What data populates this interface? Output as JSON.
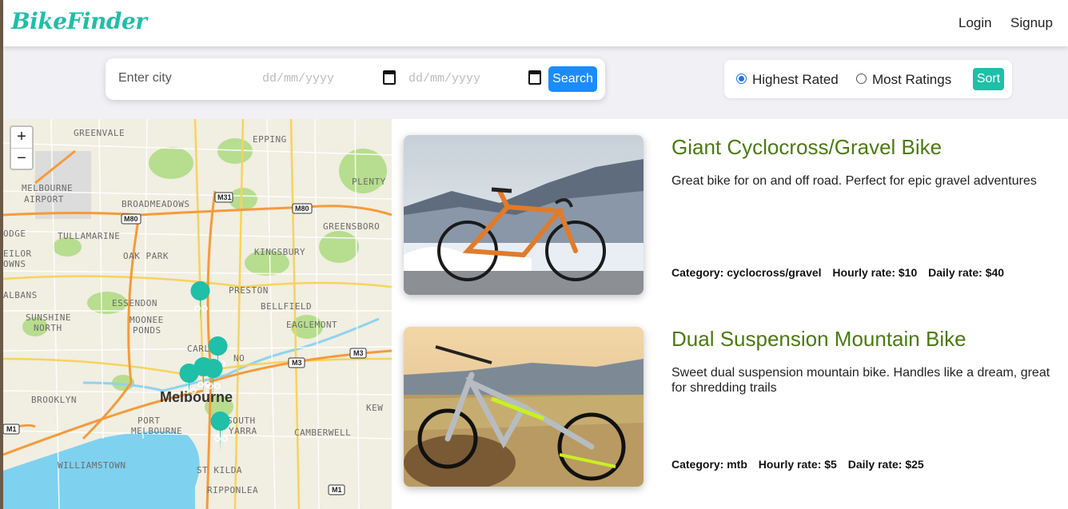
{
  "nav": {
    "brand": "BikeFinder",
    "login": "Login",
    "signup": "Signup"
  },
  "search": {
    "city_placeholder": "Enter city",
    "start_date_placeholder": "dd/mm/yyyy",
    "end_date_placeholder": "dd/mm/yyyy",
    "button": "Search"
  },
  "sort": {
    "option_highest": "Highest Rated",
    "option_most": "Most Ratings",
    "selected": "Highest Rated",
    "button": "Sort"
  },
  "map": {
    "zoom_in": "+",
    "zoom_out": "−",
    "places": [
      "GREENVALE",
      "EPPING",
      "MELBOURNE",
      "AIRPORT",
      "PLENTY",
      "BROADMEADOWS",
      "M31",
      "M80",
      "M80",
      "TULLAMARINE",
      "GREENSBORO",
      "ILOR",
      "OWNS",
      "OAK PARK",
      "KINGSBURY",
      "PRESTON",
      "ALBANS",
      "ESSENDON",
      "BELLFIELD",
      "SUNSHINE",
      "NORTH",
      "MOONEE",
      "PONDS",
      "EAGLEMONT",
      "CARLTON",
      "NO",
      "M3",
      "M3",
      "BROOKLYN",
      "Melbourne",
      "KEW",
      "PORT",
      "MELBOURNE",
      "SOUTH",
      "YARRA",
      "CAMBERWELL",
      "M1",
      "WILLIAMSTOWN",
      "ST KILDA",
      "RIPPONLEA",
      "M1",
      "ODGE"
    ]
  },
  "listings": [
    {
      "title": "Giant Cyclocross/Gravel Bike",
      "description": "Great bike for on and off road. Perfect for epic gravel adventures",
      "category": "Category: cyclocross/gravel",
      "hourly": "Hourly rate: $10",
      "daily": "Daily rate: $40"
    },
    {
      "title": "Dual Suspension Mountain Bike",
      "description": "Sweet dual suspension mountain bike. Handles like a dream, great for shredding trails",
      "category": "Category: mtb",
      "hourly": "Hourly rate: $5",
      "daily": "Daily rate: $25"
    }
  ],
  "colors": {
    "brand": "#1fbfa8",
    "search_button": "#1a8cff",
    "title": "#4b7a12",
    "marker": "#1fbfa8"
  },
  "icons": {
    "date": "calendar-icon",
    "marker": "bike-marker-icon"
  }
}
